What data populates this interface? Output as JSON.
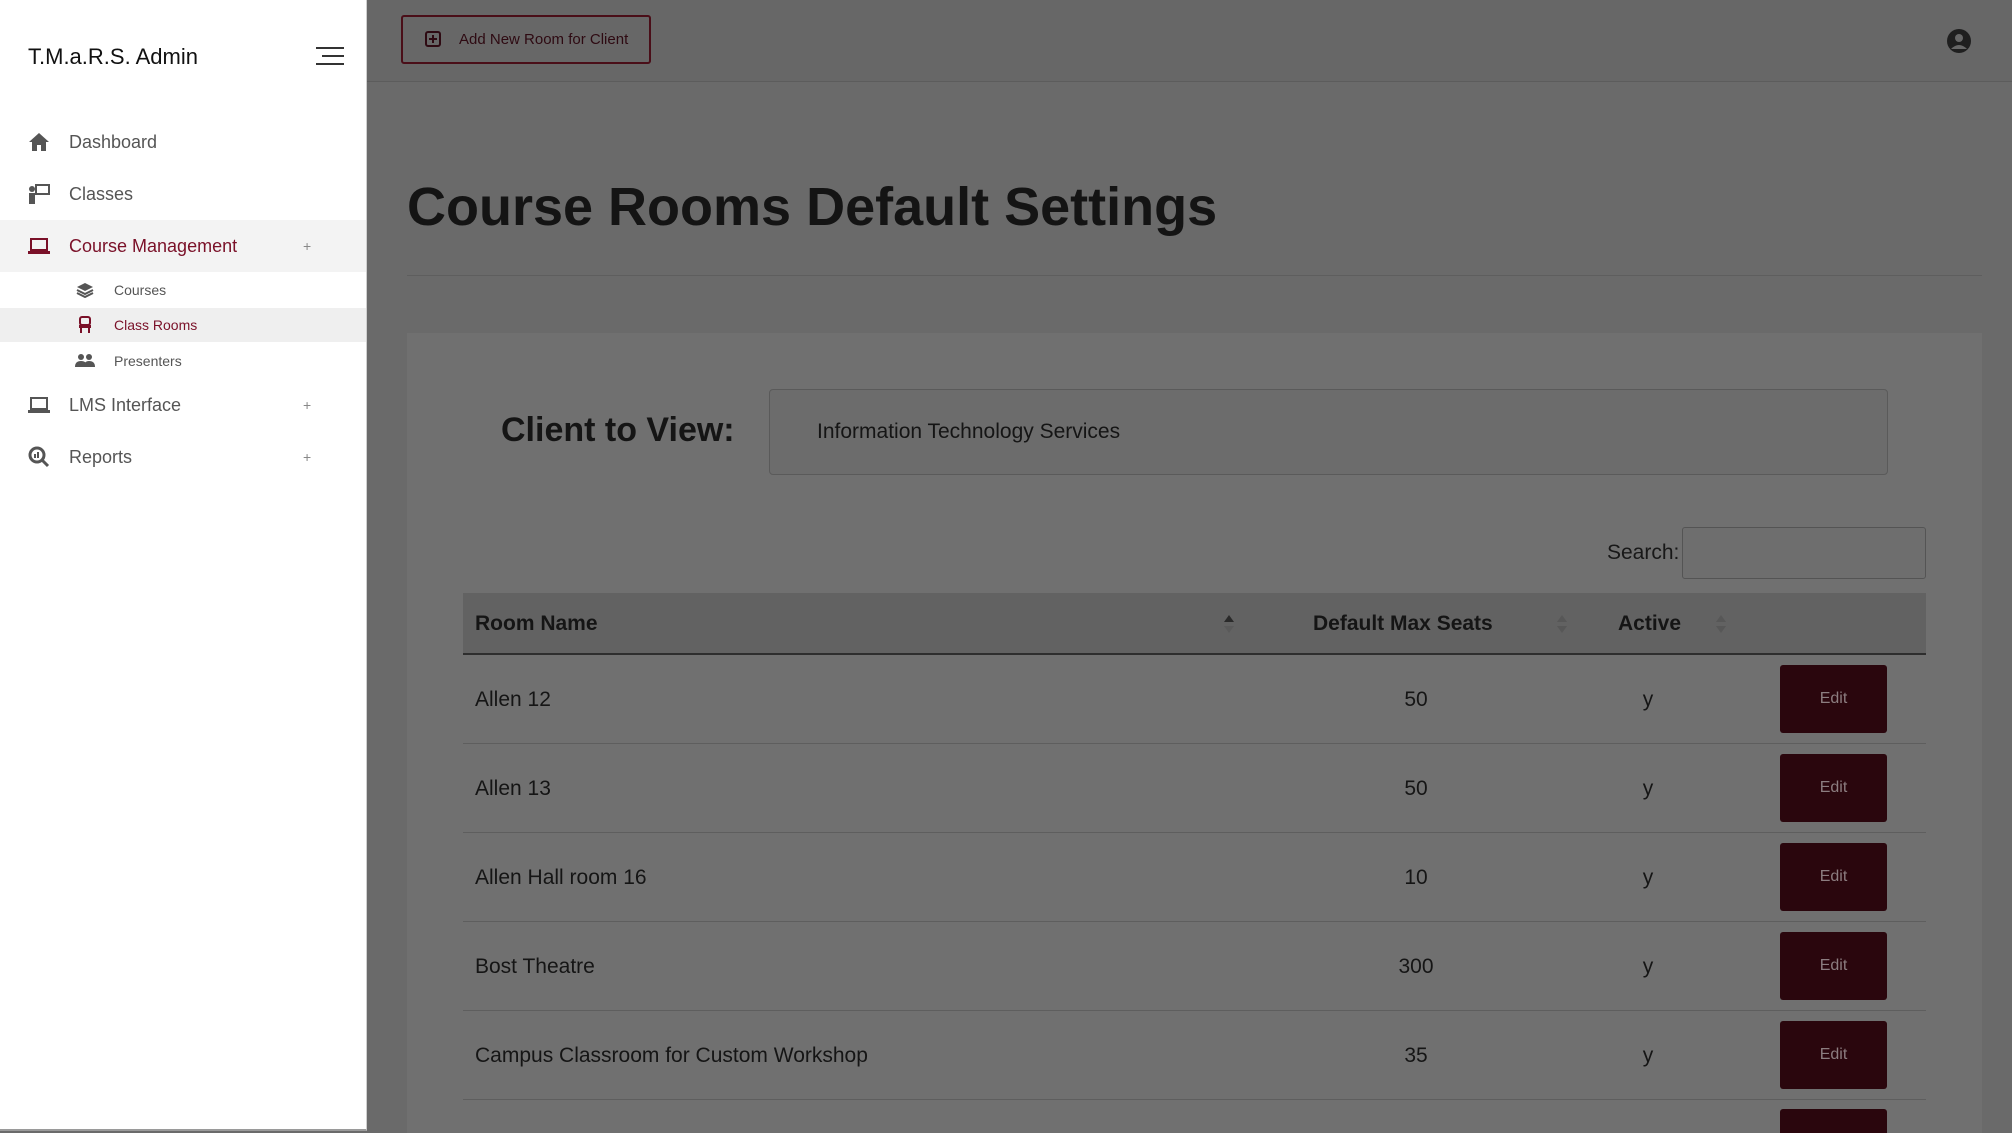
{
  "app": {
    "brand": "T.M.a.R.S. Admin"
  },
  "sidebar": {
    "items": [
      {
        "label": "Dashboard",
        "icon": "home-icon"
      },
      {
        "label": "Classes",
        "icon": "chalkboard-teacher-icon"
      },
      {
        "label": "Course Management",
        "icon": "laptop-icon",
        "expand": "+"
      },
      {
        "label": "LMS Interface",
        "icon": "laptop-icon",
        "expand": "+"
      },
      {
        "label": "Reports",
        "icon": "search-chart-icon",
        "expand": "+"
      }
    ],
    "subitems": [
      {
        "label": "Courses",
        "icon": "layers-icon"
      },
      {
        "label": "Class Rooms",
        "icon": "chair-icon"
      },
      {
        "label": "Presenters",
        "icon": "users-icon"
      }
    ]
  },
  "toolbar": {
    "add_room_label": "Add New Room for Client"
  },
  "page": {
    "title": "Course Rooms Default Settings"
  },
  "client": {
    "label": "Client to View:",
    "selected": "Information Technology Services"
  },
  "search": {
    "label": "Search:",
    "value": ""
  },
  "table": {
    "columns": [
      "Room Name",
      "Default Max Seats",
      "Active"
    ],
    "rows": [
      {
        "name": "Allen 12",
        "seats": "50",
        "active": "y",
        "action": "Edit"
      },
      {
        "name": "Allen 13",
        "seats": "50",
        "active": "y",
        "action": "Edit"
      },
      {
        "name": "Allen Hall room 16",
        "seats": "10",
        "active": "y",
        "action": "Edit"
      },
      {
        "name": "Bost Theatre",
        "seats": "300",
        "active": "y",
        "action": "Edit"
      },
      {
        "name": "Campus Classroom for Custom Workshop",
        "seats": "35",
        "active": "y",
        "action": "Edit"
      }
    ]
  },
  "colors": {
    "accent": "#7a1028",
    "button_dark": "#2a060d",
    "overlay": "#6a6a6a"
  }
}
